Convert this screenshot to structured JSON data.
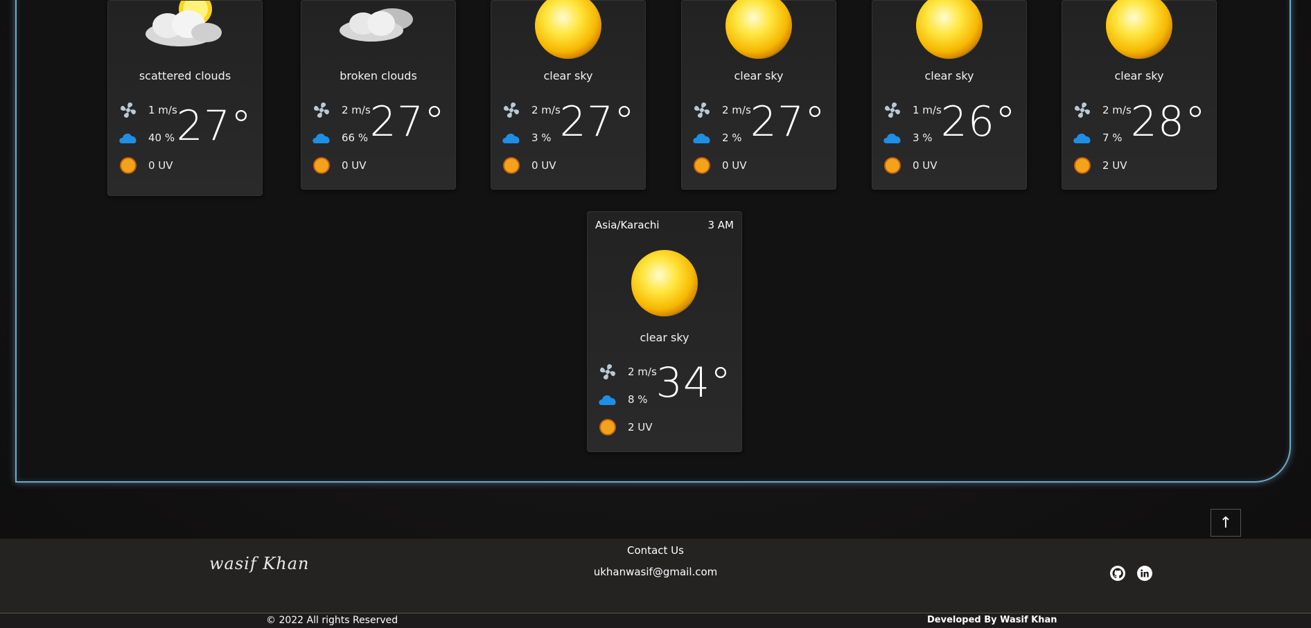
{
  "forecast": [
    {
      "description": "scattered clouds",
      "wind": "1 m/s",
      "clouds": "40 %",
      "uv": "0 UV",
      "temp": "27°",
      "icon": "sun-behind-clouds-icon"
    },
    {
      "description": "broken clouds",
      "wind": "2 m/s",
      "clouds": "66 %",
      "uv": "0 UV",
      "temp": "27°",
      "icon": "broken-clouds-icon"
    },
    {
      "description": "clear sky",
      "wind": "2 m/s",
      "clouds": "3 %",
      "uv": "0 UV",
      "temp": "27°",
      "icon": "sun-icon"
    },
    {
      "description": "clear sky",
      "wind": "2 m/s",
      "clouds": "2 %",
      "uv": "0 UV",
      "temp": "27°",
      "icon": "sun-icon"
    },
    {
      "description": "clear sky",
      "wind": "1 m/s",
      "clouds": "3 %",
      "uv": "0 UV",
      "temp": "26°",
      "icon": "sun-icon"
    },
    {
      "description": "clear sky",
      "wind": "2 m/s",
      "clouds": "7 %",
      "uv": "2 UV",
      "temp": "28°",
      "icon": "sun-icon"
    }
  ],
  "current": {
    "timezone": "Asia/Karachi",
    "time": "3 AM",
    "description": "clear sky",
    "wind": "2 m/s",
    "clouds": "8 %",
    "uv": "2 UV",
    "temp": "34°",
    "icon": "sun-icon"
  },
  "scroll_top": {
    "label": "↑"
  },
  "footer": {
    "signature": "wasif Khan",
    "contact_title": "Contact Us",
    "email": "ukhanwasif@gmail.com",
    "social": [
      "github-icon",
      "linkedin-icon"
    ],
    "copyright": "© 2022 All rights Reserved",
    "developer": "Developed By Wasif Khan"
  },
  "colors": {
    "frame_border": "#6ea8c9",
    "background": "#141313",
    "card": "#262626",
    "footer": "#252222"
  }
}
